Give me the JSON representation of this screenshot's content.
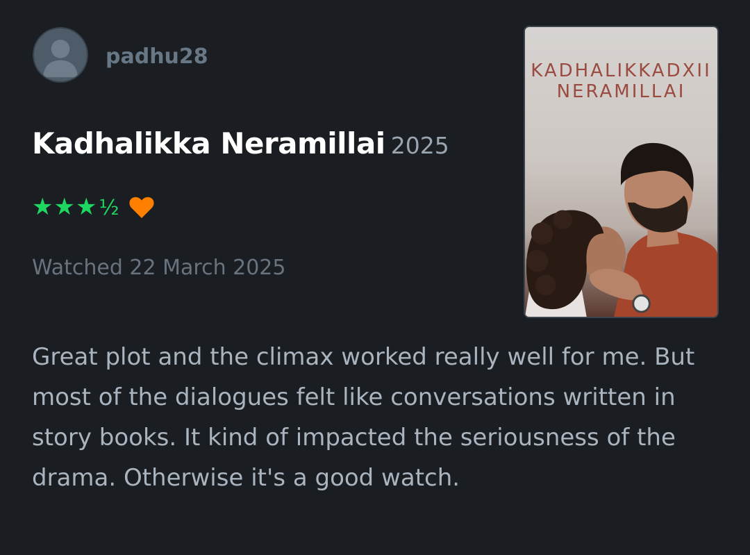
{
  "user": {
    "username": "padhu28",
    "avatar_icon": "default-user-avatar-icon"
  },
  "film": {
    "title": "Kadhalikka Neramillai",
    "year": "2025",
    "poster_title_line1": "KADHALIKKADXII",
    "poster_title_line2": "NERAMILLAI"
  },
  "rating": {
    "value": 3.5,
    "max": 5,
    "stars_text": "★★★",
    "half_text": "½",
    "liked": true,
    "star_color": "#1ed760",
    "heart_color": "#ff8000"
  },
  "watched": {
    "text": "Watched 22 March 2025"
  },
  "review": {
    "text": "Great plot and the climax worked really well for me. But most of the dialogues felt like conversations written in story books. It kind of impacted the seriousness of the drama. Otherwise it's a good watch."
  },
  "colors": {
    "background": "#1a1d22",
    "title": "#ffffff",
    "muted": "#69737e",
    "body_text": "#aab4bf"
  }
}
